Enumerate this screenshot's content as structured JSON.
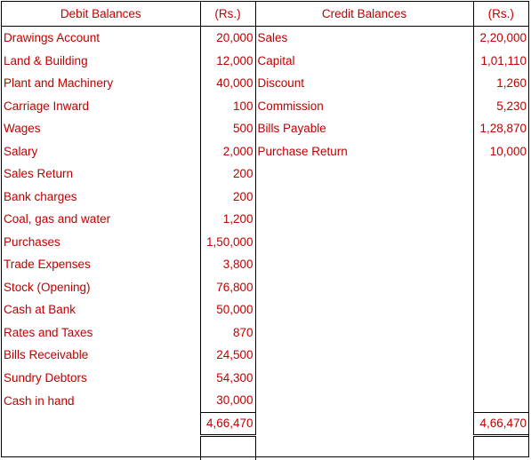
{
  "headers": {
    "debit": "Debit Balances",
    "debit_amount": "(Rs.)",
    "credit": "Credit Balances",
    "credit_amount": "(Rs.)"
  },
  "rows": [
    {
      "debit": "Drawings Account",
      "debit_amount": "20,000",
      "credit": "Sales",
      "credit_amount": "2,20,000"
    },
    {
      "debit": "Land & Building",
      "debit_amount": "12,000",
      "credit": "Capital",
      "credit_amount": "1,01,110"
    },
    {
      "debit": "Plant and Machinery",
      "debit_amount": "40,000",
      "credit": "Discount",
      "credit_amount": "1,260"
    },
    {
      "debit": "Carriage Inward",
      "debit_amount": "100",
      "credit": "Commission",
      "credit_amount": "5,230"
    },
    {
      "debit": "Wages",
      "debit_amount": "500",
      "credit": "Bills Payable",
      "credit_amount": "1,28,870"
    },
    {
      "debit": "Salary",
      "debit_amount": "2,000",
      "credit": "Purchase Return",
      "credit_amount": "10,000"
    },
    {
      "debit": "Sales Return",
      "debit_amount": "200",
      "credit": "",
      "credit_amount": ""
    },
    {
      "debit": "Bank charges",
      "debit_amount": "200",
      "credit": "",
      "credit_amount": ""
    },
    {
      "debit": "Coal, gas and water",
      "debit_amount": "1,200",
      "credit": "",
      "credit_amount": ""
    },
    {
      "debit": "Purchases",
      "debit_amount": "1,50,000",
      "credit": "",
      "credit_amount": ""
    },
    {
      "debit": "Trade Expenses",
      "debit_amount": "3,800",
      "credit": "",
      "credit_amount": ""
    },
    {
      "debit": "Stock (Opening)",
      "debit_amount": "76,800",
      "credit": "",
      "credit_amount": ""
    },
    {
      "debit": "Cash at Bank",
      "debit_amount": "50,000",
      "credit": "",
      "credit_amount": ""
    },
    {
      "debit": "Rates and Taxes",
      "debit_amount": "870",
      "credit": "",
      "credit_amount": ""
    },
    {
      "debit": "Bills Receivable",
      "debit_amount": "24,500",
      "credit": "",
      "credit_amount": ""
    },
    {
      "debit": "Sundry Debtors",
      "debit_amount": "54,300",
      "credit": "",
      "credit_amount": ""
    },
    {
      "debit": "Cash in hand",
      "debit_amount": "30,000",
      "credit": "",
      "credit_amount": ""
    }
  ],
  "totals": {
    "debit_total": "4,66,470",
    "credit_total": "4,66,470"
  },
  "colors": {
    "text": "#c00000",
    "border": "#000000"
  }
}
